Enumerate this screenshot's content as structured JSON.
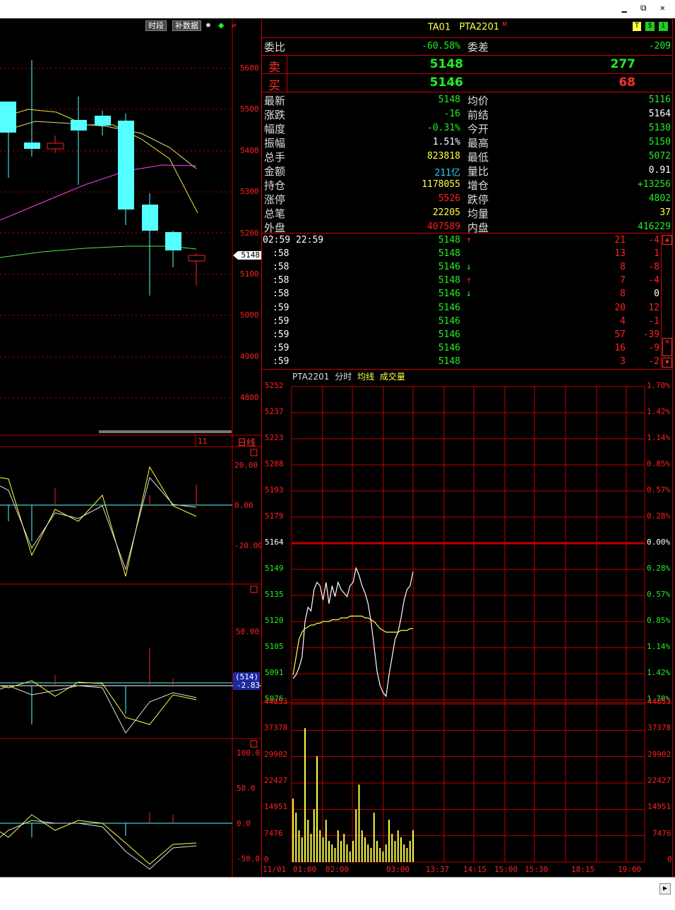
{
  "colors": {
    "up": "#ff2020",
    "down": "#54ffff",
    "green": "#22ee22",
    "yellow": "#ffff44",
    "grid": "#c00000",
    "white": "#ffffff",
    "cyan": "#30d0ff",
    "magenta": "#ff40ff",
    "lime": "#44ee44"
  },
  "window": {
    "restore_glyph": "▁ ⧉ ✕"
  },
  "kline": {
    "buttons": {
      "period": "时段",
      "patch": "补数据"
    },
    "price_ticks": [
      "5600",
      "5500",
      "5400",
      "5300",
      "5200",
      "5100",
      "5000",
      "4900",
      "4800"
    ],
    "current_price_tag": "5148",
    "period_label": "日线",
    "date_marker": "11",
    "osc1_ticks": [
      "20.00",
      "0.00",
      "-20.00"
    ],
    "osc2_ticks": [
      "50.00"
    ],
    "osc2_tag_top": "(514)",
    "osc2_tag_bottom": "-2.83",
    "osc3_ticks": [
      "100.0",
      "50.0",
      "0.0",
      "-50.0"
    ]
  },
  "header": {
    "symbol": "TA01",
    "name": "PTA2201",
    "superscript": "M",
    "icons": [
      "T",
      "$",
      "i"
    ]
  },
  "orderbook": {
    "weibi_label": "委比",
    "weibi_value": "-60.58%",
    "weicha_label": "委差",
    "weicha_value": "-209",
    "sell_label": "卖",
    "sell_price": "5148",
    "sell_vol": "277",
    "buy_label": "买",
    "buy_price": "5146",
    "buy_vol": "68"
  },
  "stats": [
    {
      "l1": "最新",
      "v1": "5148",
      "c1": "green",
      "l2": "均价",
      "v2": "5116",
      "c2": "green"
    },
    {
      "l1": "涨跌",
      "v1": "-16",
      "c1": "green",
      "l2": "前结",
      "v2": "5164",
      "c2": "white"
    },
    {
      "l1": "幅度",
      "v1": "-0.31%",
      "c1": "green",
      "l2": "今开",
      "v2": "5130",
      "c2": "green"
    },
    {
      "l1": "振幅",
      "v1": "1.51%",
      "c1": "white",
      "l2": "最高",
      "v2": "5150",
      "c2": "green"
    },
    {
      "l1": "总手",
      "v1": "823818",
      "c1": "yellow",
      "l2": "最低",
      "v2": "5072",
      "c2": "green"
    },
    {
      "l1": "金额",
      "v1": "211亿",
      "c1": "cyan",
      "l2": "量比",
      "v2": "0.91",
      "c2": "white"
    },
    {
      "l1": "持仓",
      "v1": "1178055",
      "c1": "yellow",
      "l2": "增仓",
      "v2": "+13256",
      "c2": "green"
    },
    {
      "l1": "涨停",
      "v1": "5526",
      "c1": "up",
      "l2": "跌停",
      "v2": "4802",
      "c2": "green"
    },
    {
      "l1": "总笔",
      "v1": "22205",
      "c1": "yellow",
      "l2": "均量",
      "v2": "37",
      "c2": "yellow"
    },
    {
      "l1": "外盘",
      "v1": "407589",
      "c1": "up",
      "l2": "内盘",
      "v2": "416229",
      "c2": "green"
    }
  ],
  "ticks": [
    {
      "time": "02:59 22:59",
      "price": "5148",
      "arrow": "↑",
      "dir": "up",
      "vol": "21",
      "chg": "-4",
      "cc": "up"
    },
    {
      "time": ":58",
      "price": "5148",
      "arrow": "",
      "dir": "",
      "vol": "13",
      "chg": "1",
      "cc": "up"
    },
    {
      "time": ":58",
      "price": "5146",
      "arrow": "↓",
      "dir": "down",
      "vol": "8",
      "chg": "-8",
      "cc": "up"
    },
    {
      "time": ":58",
      "price": "5148",
      "arrow": "↑",
      "dir": "up",
      "vol": "7",
      "chg": "-4",
      "cc": "up"
    },
    {
      "time": ":58",
      "price": "5146",
      "arrow": "↓",
      "dir": "down",
      "vol": "8",
      "chg": "0",
      "cc": "white"
    },
    {
      "time": ":59",
      "price": "5146",
      "arrow": "",
      "dir": "",
      "vol": "20",
      "chg": "12",
      "cc": "up"
    },
    {
      "time": ":59",
      "price": "5146",
      "arrow": "",
      "dir": "",
      "vol": "4",
      "chg": "-1",
      "cc": "up"
    },
    {
      "time": ":59",
      "price": "5146",
      "arrow": "",
      "dir": "",
      "vol": "57",
      "chg": "-39",
      "cc": "up"
    },
    {
      "time": ":59",
      "price": "5146",
      "arrow": "",
      "dir": "",
      "vol": "16",
      "chg": "-9",
      "cc": "up"
    },
    {
      "time": ":59",
      "price": "5148",
      "arrow": "",
      "dir": "",
      "vol": "3",
      "chg": "-2",
      "cc": "up"
    }
  ],
  "intraday": {
    "title_name": "PTA2201",
    "title_mode": "分时",
    "title_avg": "均线",
    "title_vol": "成交量",
    "price_ticks": [
      "5252",
      "5237",
      "5223",
      "5208",
      "5193",
      "5179",
      "5164",
      "5149",
      "5135",
      "5120",
      "5105",
      "5091",
      "5076"
    ],
    "pct_ticks": [
      "1.70%",
      "1.42%",
      "1.14%",
      "0.85%",
      "0.57%",
      "0.28%",
      "0.00%",
      "0.28%",
      "0.57%",
      "0.85%",
      "1.14%",
      "1.42%",
      "1.70%"
    ],
    "vol_ticks": [
      "44853",
      "37378",
      "29902",
      "22427",
      "14951",
      "7476",
      "0"
    ],
    "time_labels": [
      "11/01",
      "01:00",
      "02:00",
      "03:00",
      "13:37",
      "14:15",
      "15:00",
      "15:30",
      "18:15",
      "19:00"
    ]
  },
  "chart_data": {
    "type": "line",
    "title": "",
    "xlabel": "",
    "ylabel": "",
    "ylim": [
      5076,
      5252
    ],
    "prev_settle": 5164,
    "series": [
      {
        "values": [
          5088,
          5090,
          5094,
          5100,
          5120,
          5128,
          5126,
          5138,
          5142,
          5140,
          5132,
          5142,
          5130,
          5140,
          5134,
          5142,
          5138,
          5136,
          5134,
          5140,
          5142,
          5150,
          5146,
          5140,
          5136,
          5130,
          5120,
          5106,
          5092,
          5084,
          5080,
          5078,
          5090,
          5100,
          5110,
          5114,
          5122,
          5132,
          5138,
          5140,
          5148
        ]
      },
      {
        "values": [
          5090,
          5100,
          5110,
          5114,
          5116,
          5117,
          5118,
          5118,
          5119,
          5119,
          5120,
          5120,
          5120,
          5121,
          5121,
          5121,
          5122,
          5122,
          5122,
          5123,
          5123,
          5123,
          5123,
          5123,
          5122,
          5122,
          5121,
          5120,
          5118,
          5116,
          5115,
          5114,
          5114,
          5114,
          5114,
          5114,
          5115,
          5115,
          5115,
          5116,
          5116
        ]
      }
    ],
    "volume": [
      18000,
      14000,
      9000,
      7000,
      38000,
      12000,
      8000,
      15000,
      30000,
      9000,
      7000,
      12000,
      6000,
      5000,
      4000,
      9000,
      6000,
      8000,
      5000,
      3000,
      6000,
      15000,
      22000,
      9000,
      7000,
      5000,
      4000,
      14000,
      6000,
      4000,
      3000,
      5000,
      12000,
      8000,
      6000,
      9000,
      7000,
      5000,
      4000,
      6000,
      9000
    ]
  }
}
